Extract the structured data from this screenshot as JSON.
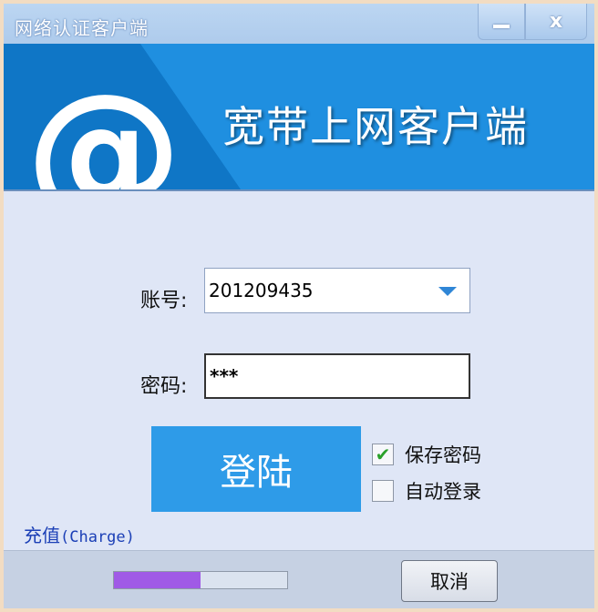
{
  "window": {
    "title": "网络认证客户端",
    "minimize_label": "",
    "close_label": "x"
  },
  "banner": {
    "logo_text": "@",
    "title": "宽带上网客户端"
  },
  "form": {
    "account_label": "账号:",
    "account_value": "201209435",
    "password_label": "密码:",
    "password_value": "***",
    "login_label": "登陆",
    "save_password_label": "保存密码",
    "save_password_checked": true,
    "auto_login_label": "自动登录",
    "auto_login_checked": false
  },
  "links": {
    "charge_cn": "充值",
    "charge_en": "(Charge)"
  },
  "footer": {
    "progress": 0.5,
    "cancel_label": "取消"
  },
  "colors": {
    "banner": "#1f8fe0",
    "login_button": "#2e9be8",
    "progress_fill": "#a05ae6",
    "link": "#1b3fb6"
  }
}
